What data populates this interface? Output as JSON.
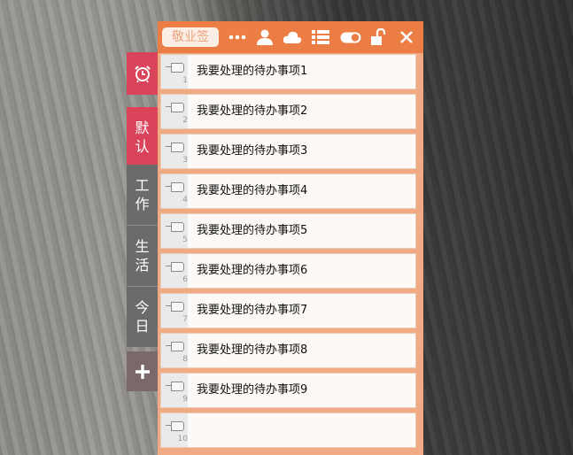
{
  "app": {
    "logo_text": "敬业签",
    "accent_color": "#ec7d45",
    "active_tab_color": "#d9445a"
  },
  "toolbar": {
    "icons": [
      "more-icon",
      "user-icon",
      "cloud-icon",
      "list-icon",
      "toggle-icon",
      "unlock-icon",
      "close-icon"
    ]
  },
  "sidebar": {
    "alarm_icon": "alarm-clock-icon",
    "tabs": [
      {
        "line1": "默",
        "line2": "认",
        "active": true
      },
      {
        "line1": "工",
        "line2": "作",
        "active": false
      },
      {
        "line1": "生",
        "line2": "活",
        "active": false
      },
      {
        "line1": "今",
        "line2": "日",
        "active": false
      }
    ],
    "add_icon": "plus-icon"
  },
  "todos": [
    {
      "num": "1",
      "text": "我要处理的待办事项1"
    },
    {
      "num": "2",
      "text": "我要处理的待办事项2"
    },
    {
      "num": "3",
      "text": "我要处理的待办事项3"
    },
    {
      "num": "4",
      "text": "我要处理的待办事项4"
    },
    {
      "num": "5",
      "text": "我要处理的待办事项5"
    },
    {
      "num": "6",
      "text": "我要处理的待办事项6"
    },
    {
      "num": "7",
      "text": "我要处理的待办事项7"
    },
    {
      "num": "8",
      "text": "我要处理的待办事项8"
    },
    {
      "num": "9",
      "text": "我要处理的待办事项9"
    },
    {
      "num": "10",
      "text": ""
    }
  ]
}
